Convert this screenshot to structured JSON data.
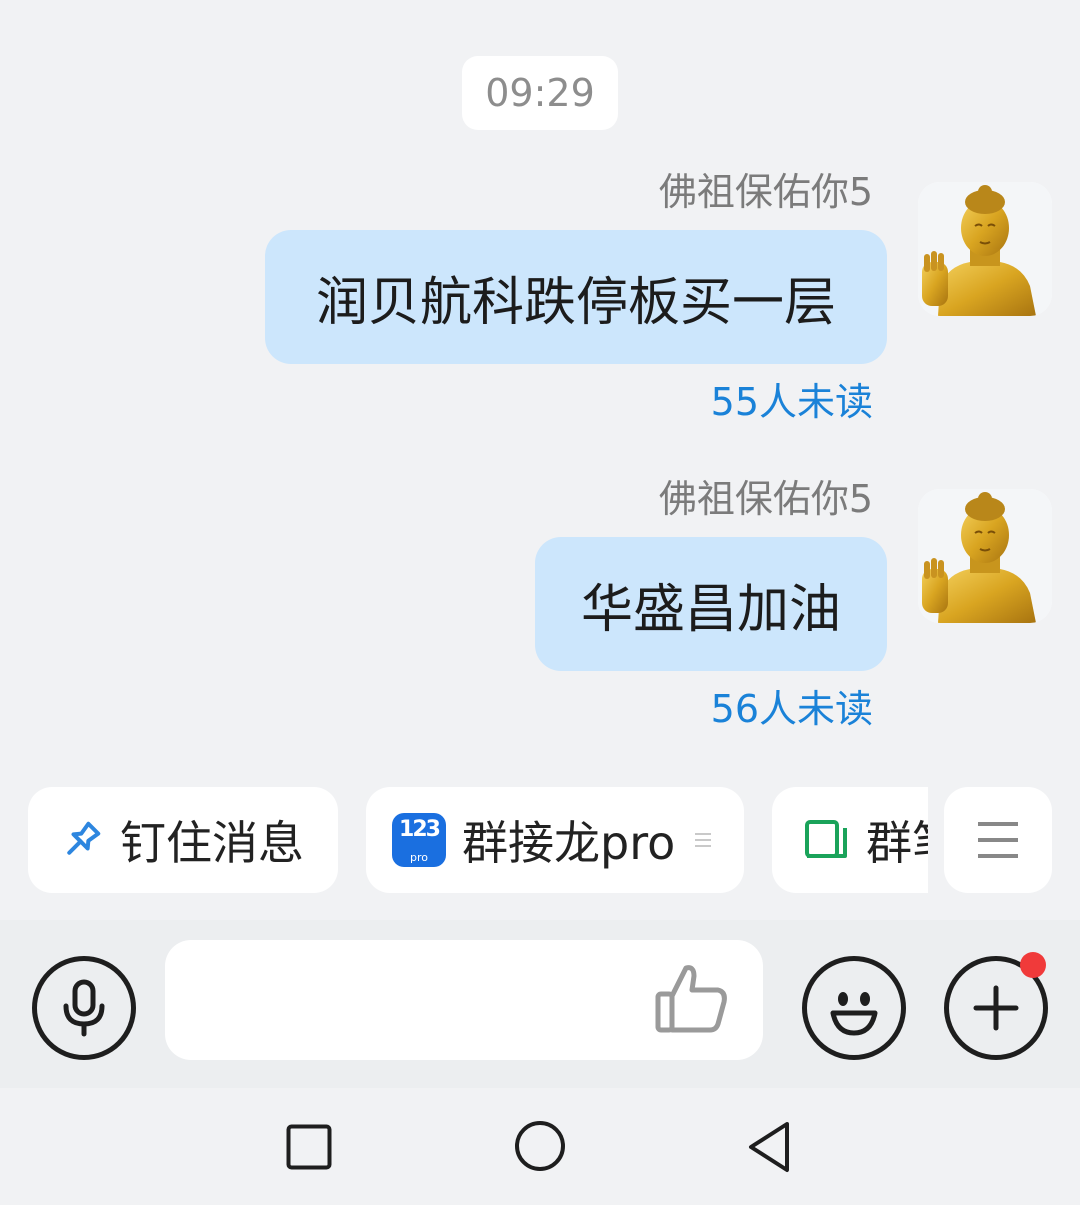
{
  "chat": {
    "timestamp": "09:29",
    "messages": [
      {
        "sender": "佛祖保佑你5",
        "text": "润贝航科跌停板买一层",
        "read_status": "55人未读"
      },
      {
        "sender": "佛祖保佑你5",
        "text": "华盛昌加油",
        "read_status": "56人未读"
      }
    ]
  },
  "shortcuts": {
    "pin": {
      "label": "钉住消息",
      "icon": "pin-icon"
    },
    "solitaire": {
      "label": "群接龙pro",
      "icon": "solitaire-app-icon",
      "app_icon_text": "123",
      "app_icon_sub": "pro"
    },
    "group_notes": {
      "label": "群笔记",
      "icon": "book-icon"
    },
    "more": {
      "icon": "menu-icon"
    }
  },
  "input": {
    "placeholder": ""
  },
  "colors": {
    "bubble": "#cce6fc",
    "read_status": "#1a82d8",
    "notification_dot": "#f03a3a"
  }
}
